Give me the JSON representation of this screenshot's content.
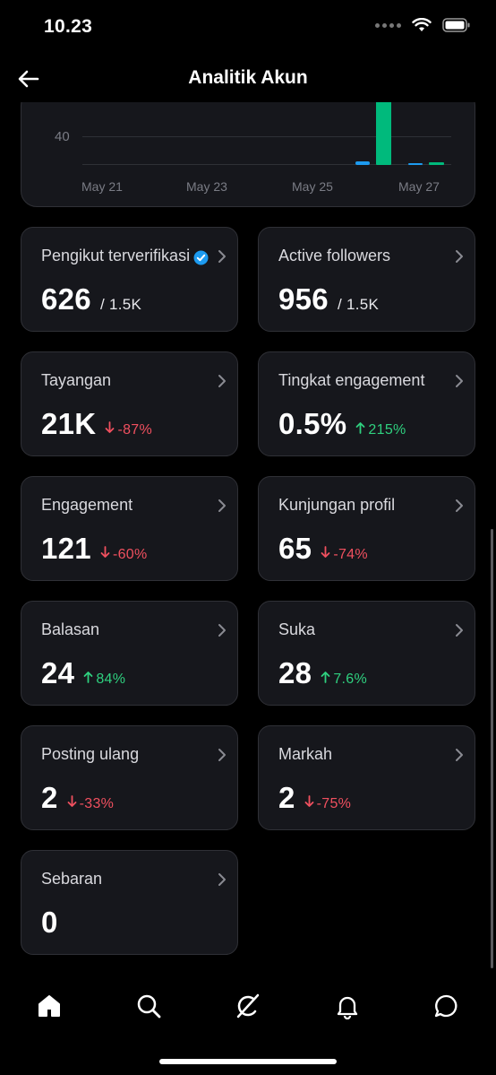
{
  "status": {
    "time": "10.23"
  },
  "header": {
    "title": "Analitik Akun"
  },
  "chart": {
    "y_tick": "40",
    "x_ticks": [
      "May 21",
      "May 23",
      "May 25",
      "May 27"
    ]
  },
  "chart_data": {
    "type": "bar",
    "series": [
      {
        "color": "#1d9bf0"
      },
      {
        "color": "#00ba7c"
      }
    ],
    "visible_y_tick": 40,
    "x_ticks": [
      "May 21",
      "May 23",
      "May 25",
      "May 27"
    ]
  },
  "cards": [
    {
      "label": "Pengikut terverifikasi",
      "value": "626",
      "total": "/ 1.5K",
      "verified": true
    },
    {
      "label": "Active followers",
      "value": "956",
      "total": "/ 1.5K"
    },
    {
      "label": "Tayangan",
      "value": "21K",
      "delta": "-87%",
      "dir": "down"
    },
    {
      "label": "Tingkat engagement",
      "value": "0.5%",
      "delta": "215%",
      "dir": "up"
    },
    {
      "label": "Engagement",
      "value": "121",
      "delta": "-60%",
      "dir": "down"
    },
    {
      "label": "Kunjungan profil",
      "value": "65",
      "delta": "-74%",
      "dir": "down"
    },
    {
      "label": "Balasan",
      "value": "24",
      "delta": "84%",
      "dir": "up"
    },
    {
      "label": "Suka",
      "value": "28",
      "delta": "7.6%",
      "dir": "up"
    },
    {
      "label": "Posting ulang",
      "value": "2",
      "delta": "-33%",
      "dir": "down"
    },
    {
      "label": "Markah",
      "value": "2",
      "delta": "-75%",
      "dir": "down"
    },
    {
      "label": "Sebaran",
      "value": "0"
    }
  ],
  "tabs": [
    "home-icon",
    "search-icon",
    "grok-icon",
    "notifications-icon",
    "messages-icon"
  ],
  "colors": {
    "up": "#2fd07f",
    "down": "#f0505f",
    "verified": "#1d9bf0",
    "bar_green": "#00ba7c",
    "bar_blue": "#1d9bf0"
  }
}
